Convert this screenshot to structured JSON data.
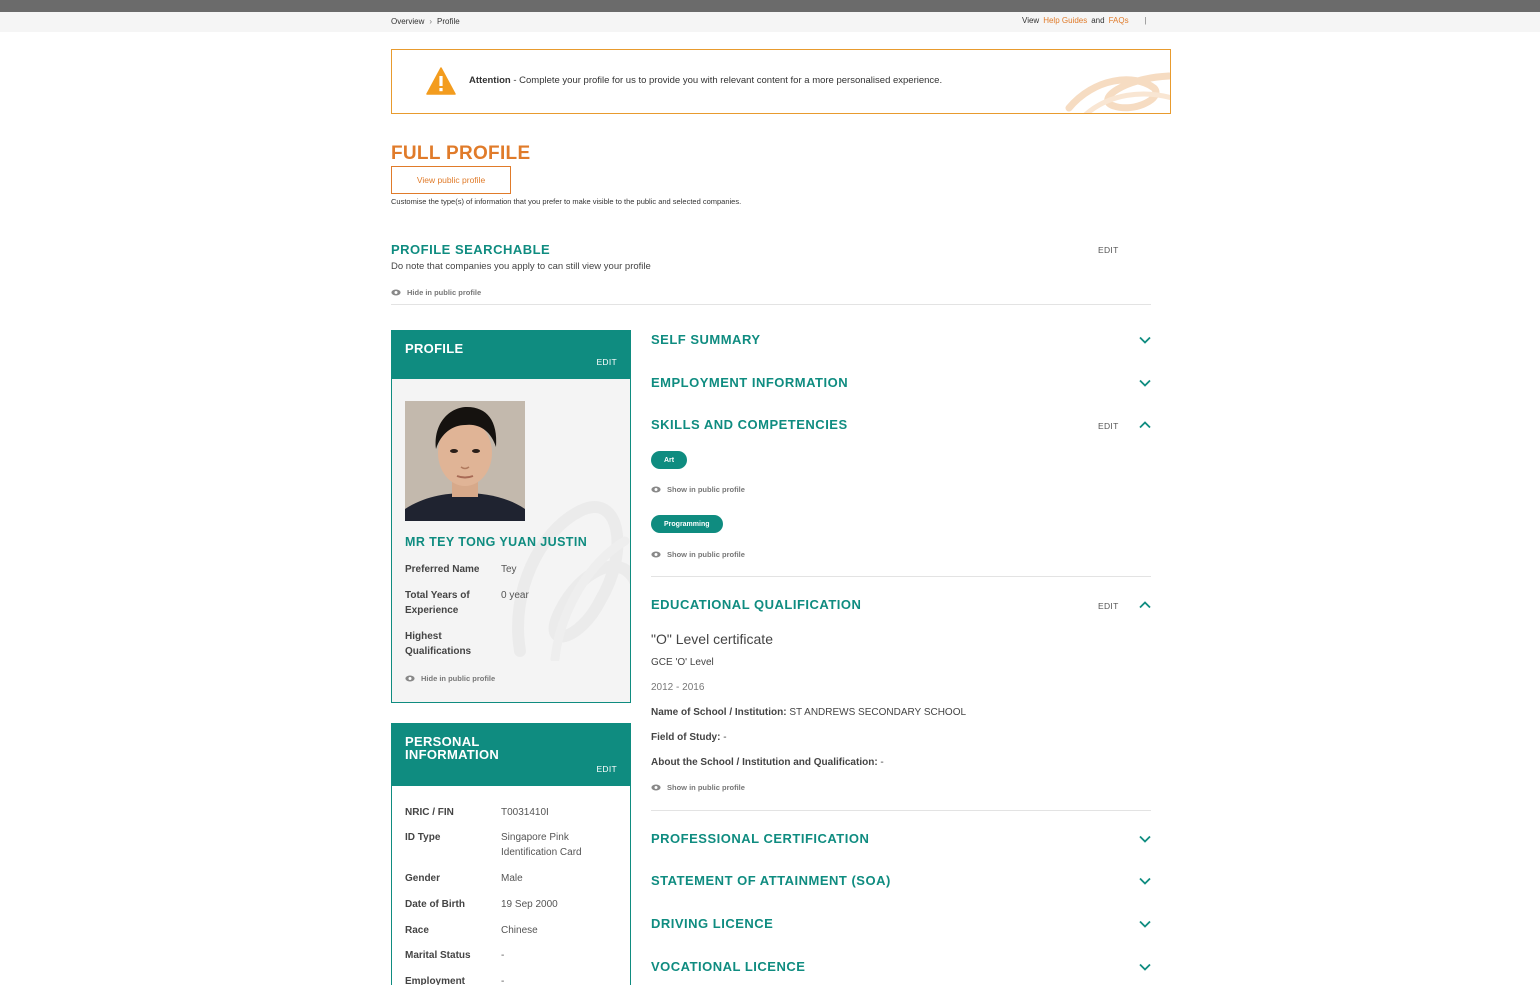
{
  "nav": {
    "breadcrumb": [
      "Overview",
      "Profile"
    ],
    "help": {
      "view": "View",
      "help_guides": "Help Guides",
      "and": "and",
      "faqs": "FAQs",
      "pipe": "|"
    }
  },
  "alert": {
    "strong": "Attention",
    "text": " - Complete your profile for us to provide you with relevant content for a more personalised experience."
  },
  "full_profile": {
    "title": "FULL PROFILE",
    "view_public_button": "View public profile",
    "note": "Customise the type(s) of information that you prefer to make visible to the public and selected companies."
  },
  "profile_searchable": {
    "title": "PROFILE SEARCHABLE",
    "edit": "EDIT",
    "note": "Do note that companies you apply to can still view your profile",
    "visibility": "Hide in public profile"
  },
  "profile_card": {
    "title": "PROFILE",
    "edit": "EDIT",
    "name": "MR  TEY TONG YUAN JUSTIN",
    "fields": [
      {
        "label": "Preferred Name",
        "value": "Tey"
      },
      {
        "label": "Total Years of Experience",
        "value": "0 year"
      },
      {
        "label": "Highest Qualifications",
        "value": ""
      }
    ],
    "visibility": "Hide in public profile"
  },
  "personal_card": {
    "title_line1": "PERSONAL",
    "title_line2": "INFORMATION",
    "edit": "EDIT",
    "fields": [
      {
        "label": "NRIC / FIN",
        "value": "T0031410I"
      },
      {
        "label": "ID Type",
        "value": "Singapore Pink Identification Card"
      },
      {
        "label": "Gender",
        "value": "Male"
      },
      {
        "label": "Date of Birth",
        "value": "19 Sep 2000"
      },
      {
        "label": "Race",
        "value": "Chinese"
      },
      {
        "label": "Marital Status",
        "value": "-"
      },
      {
        "label": "Employment",
        "value": "-"
      }
    ]
  },
  "sections": {
    "self_summary": "SELF SUMMARY",
    "employment": "EMPLOYMENT INFORMATION",
    "skills": "SKILLS AND COMPETENCIES",
    "education": "EDUCATIONAL QUALIFICATION",
    "professional": "PROFESSIONAL CERTIFICATION",
    "soa": "STATEMENT OF ATTAINMENT (SOA)",
    "driving": "DRIVING LICENCE",
    "vocational": "VOCATIONAL LICENCE",
    "edit": "EDIT"
  },
  "skills": [
    {
      "name": "Art",
      "visibility": "Show in public profile"
    },
    {
      "name": "Programming",
      "visibility": "Show in public profile"
    }
  ],
  "education": {
    "name": "\"O\" Level certificate",
    "level": "GCE 'O' Level",
    "years": "2012 -  2016",
    "school_label": "Name of School / Institution:",
    "school_value": " ST ANDREWS SECONDARY SCHOOL",
    "field_label": "Field of Study:",
    "field_value": " -",
    "about_label": "About the School / Institution and Qualification:",
    "about_value": " -",
    "visibility": "Show in public profile"
  },
  "colors": {
    "teal": "#0f8c80",
    "orange": "#e07b2a"
  }
}
